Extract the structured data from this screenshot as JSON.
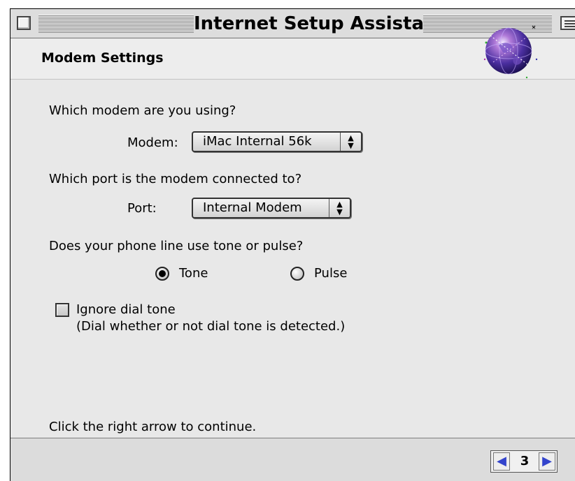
{
  "window": {
    "title": "Internet Setup Assistant"
  },
  "header": {
    "title": "Modem Settings"
  },
  "modem": {
    "question": "Which modem are you using?",
    "label": "Modem:",
    "selected": "iMac Internal 56k"
  },
  "port": {
    "question": "Which port is the modem connected to?",
    "label": "Port:",
    "selected": "Internal Modem"
  },
  "dialing": {
    "question": "Does your phone line use tone or pulse?",
    "options": [
      {
        "label": "Tone",
        "selected": true
      },
      {
        "label": "Pulse",
        "selected": false
      }
    ]
  },
  "dial_tone": {
    "label": "Ignore dial tone",
    "note": "(Dial whether or not dial tone is detected.)",
    "checked": false
  },
  "instructions": "Click the right arrow to continue.",
  "navigation": {
    "page": "3"
  },
  "icons": [
    "close-box-icon",
    "collapse-box-icon",
    "globe-icon",
    "popup-arrows-icon",
    "left-arrow-icon",
    "right-arrow-icon"
  ]
}
